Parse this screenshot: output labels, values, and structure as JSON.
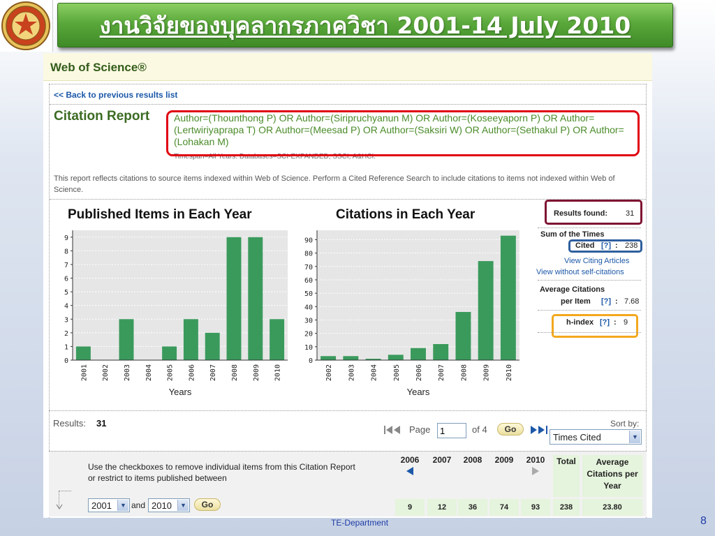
{
  "slide": {
    "title": "งานวิจัยของบุคลากรภาควิชา 2001-14 July 2010",
    "footer": "TE-Department",
    "page_number": "8"
  },
  "wos": {
    "header_title": "Web of Science®",
    "back_link": "<< Back to previous results list",
    "report_title": "Citation Report",
    "query": "Author=(Thounthong P) OR Author=(Siripruchyanun M) OR Author=(Koseeyaporn P) OR Author=(Lertwiriyaprapa T) OR Author=(Meesad P) OR Author=(Saksiri W) OR Author=(Sethakul P) OR Author=(Lohakan M)",
    "timespan": "Timespan=All Years. Databases=SCI-EXPANDED, SSCI, A&HCI.",
    "note": "This report reflects citations to source items indexed within Web of Science. Perform a Cited Reference Search to include citations to items not indexed within Web of Science."
  },
  "stats": {
    "results_found_label": "Results found:",
    "results_found_value": "31",
    "sum_label_1": "Sum of the Times",
    "sum_label_2": "Cited",
    "qmark": "[?]",
    "colon": ":",
    "sum_value": "238",
    "view_citing": "View Citing Articles",
    "view_without": "View without self-citations",
    "avg_label_1": "Average Citations",
    "avg_label_2": "per Item",
    "avg_value": "7.68",
    "h_label": "h-index",
    "h_value": "9"
  },
  "results_bar": {
    "label": "Results:",
    "count": "31",
    "page_label": "Page",
    "page_value": "1",
    "of_label": "of 4",
    "go_label": "Go",
    "sort_label": "Sort by:",
    "sort_value": "Times Cited"
  },
  "restrict": {
    "text_1": "Use the checkboxes to remove individual items from this Citation Report",
    "text_2": "or restrict to items published between",
    "from_year": "2001",
    "and_label": "and",
    "to_year": "2010",
    "go_label": "Go"
  },
  "year_table": {
    "headers": [
      "2006",
      "2007",
      "2008",
      "2009",
      "2010",
      "Total",
      "Average Citations per Year"
    ],
    "values": [
      "9",
      "12",
      "36",
      "74",
      "93",
      "238",
      "23.80"
    ]
  },
  "chart_data": [
    {
      "type": "bar",
      "title": "Published Items in Each Year",
      "xlabel": "Years",
      "ylabel": "",
      "categories": [
        "2001",
        "2002",
        "2003",
        "2004",
        "2005",
        "2006",
        "2007",
        "2008",
        "2009",
        "2010"
      ],
      "values": [
        1,
        0,
        3,
        0,
        1,
        3,
        2,
        9,
        9,
        3
      ],
      "ylim": [
        0,
        9.5
      ],
      "yticks": [
        0,
        1,
        2,
        3,
        4,
        5,
        6,
        7,
        8,
        9
      ],
      "grid": true,
      "color": "#3a9a5c"
    },
    {
      "type": "bar",
      "title": "Citations in Each Year",
      "xlabel": "Years",
      "ylabel": "",
      "categories": [
        "2002",
        "2003",
        "2004",
        "2005",
        "2006",
        "2007",
        "2008",
        "2009",
        "2010"
      ],
      "values": [
        3,
        3,
        1,
        4,
        9,
        12,
        36,
        74,
        93
      ],
      "ylim": [
        0,
        97
      ],
      "yticks": [
        0,
        10,
        20,
        30,
        40,
        50,
        60,
        70,
        80,
        90
      ],
      "grid": true,
      "color": "#3a9a5c"
    }
  ]
}
